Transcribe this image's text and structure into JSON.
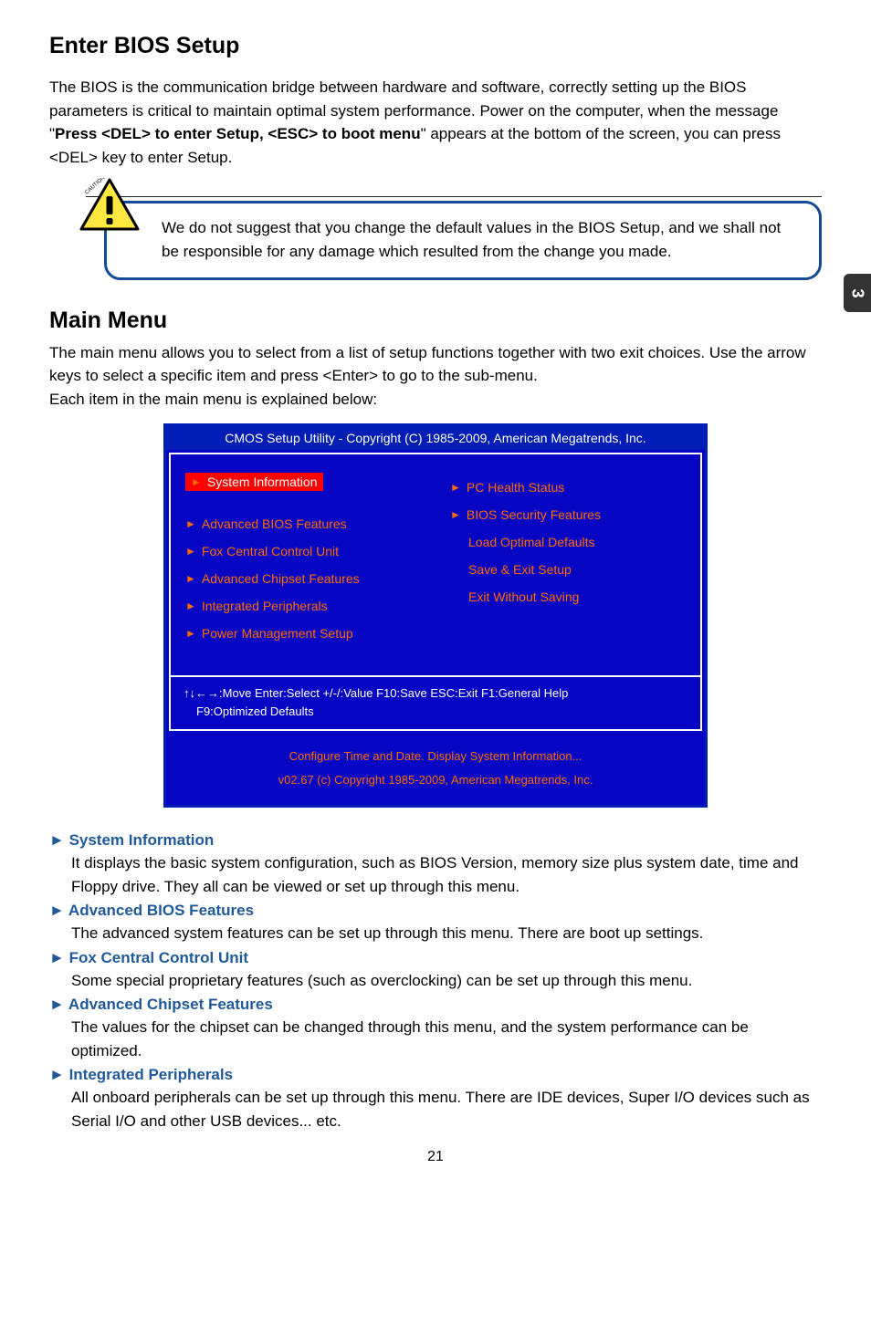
{
  "sideTab": "3",
  "section1": {
    "heading": "Enter BIOS Setup",
    "para_pre": "The BIOS is the communication bridge between hardware and software, correctly setting up the BIOS parameters is critical to maintain optimal system performance. Power on the computer, when the message \"",
    "para_bold": "Press <DEL> to enter Setup, <ESC> to boot menu",
    "para_post": "\" appears at the bottom of the screen, you can press <DEL> key to enter Setup."
  },
  "caution": {
    "text": "We do not suggest that you change the default values in the BIOS Setup, and we shall not be responsible for any damage which resulted from the change you made.",
    "label": "CAUTION"
  },
  "section2": {
    "heading": "Main Menu",
    "para": "The main menu allows you to select from a list of setup functions together with two exit choices. Use the arrow keys to select a specific item and press <Enter> to go to the sub-menu.\nEach item in the main menu is explained below:"
  },
  "bios": {
    "title": "CMOS Setup Utility - Copyright (C) 1985-2009, American Megatrends, Inc.",
    "left": [
      {
        "label": "System Information",
        "tri": true,
        "highlight": true
      },
      {
        "label": "Advanced BIOS Features",
        "tri": true
      },
      {
        "label": "Fox Central Control Unit",
        "tri": true
      },
      {
        "label": "Advanced Chipset Features",
        "tri": true
      },
      {
        "label": "Integrated Peripherals",
        "tri": true
      },
      {
        "label": "Power Management Setup",
        "tri": true
      }
    ],
    "right": [
      {
        "label": "PC Health Status",
        "tri": true
      },
      {
        "label": "BIOS Security Features",
        "tri": true
      },
      {
        "label": "Load Optimal Defaults",
        "tri": false
      },
      {
        "label": "Save & Exit Setup",
        "tri": false
      },
      {
        "label": "Exit Without Saving",
        "tri": false
      }
    ],
    "help1": "↑↓←→:Move   Enter:Select   +/-/:Value   F10:Save   ESC:Exit   F1:General Help",
    "help2": "F9:Optimized Defaults",
    "footer1": "Configure Time and Date.   Display System Information...",
    "footer2": "v02.67   (c) Copyright 1985-2009, American Megatrends, Inc."
  },
  "descriptions": [
    {
      "head": "System Information",
      "text": "It displays the basic system configuration, such as BIOS Version, memory size plus system date, time and Floppy drive. They all can be viewed or set up through this menu."
    },
    {
      "head": "Advanced BIOS Features",
      "text": "The advanced system features can be set up through this menu. There are boot up settings."
    },
    {
      "head": "Fox Central Control Unit",
      "text": "Some special proprietary features (such as overclocking) can be set up through this menu."
    },
    {
      "head": "Advanced Chipset Features",
      "text": "The values for the chipset can be changed through this menu, and the system performance can be optimized."
    },
    {
      "head": "Integrated Peripherals",
      "text": "All onboard peripherals can be set up through this menu. There are IDE devices, Super I/O devices such as Serial I/O and other USB devices... etc."
    }
  ],
  "pageNumber": "21"
}
